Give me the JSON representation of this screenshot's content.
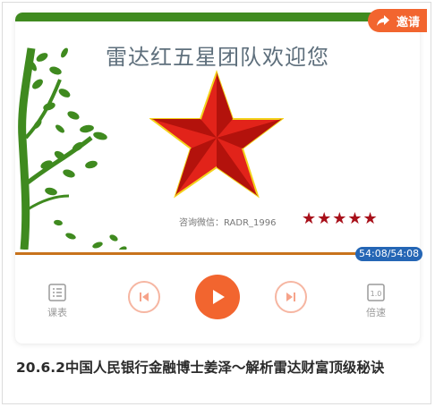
{
  "cover": {
    "title": "雷达红五星团队欢迎您",
    "contact": "咨询微信：RADR_1996",
    "rating_stars": "★★★★★",
    "colors": {
      "top_bar": "#3f8a1f",
      "star_red": "#e2231a",
      "star_border": "#f3d21c",
      "tree": "#3f8a1f"
    }
  },
  "invite": {
    "label": "邀请",
    "icon": "share-icon"
  },
  "player": {
    "time": "54:08/54:08",
    "progress": 1.0,
    "controls": {
      "playlist_label": "课表",
      "speed_label": "倍速",
      "speed_value": "1.0"
    },
    "accent_color": "#f2652f"
  },
  "episode": {
    "title": "20.6.2中国人民银行金融博士姜泽～解析雷达财富顶级秘诀"
  }
}
